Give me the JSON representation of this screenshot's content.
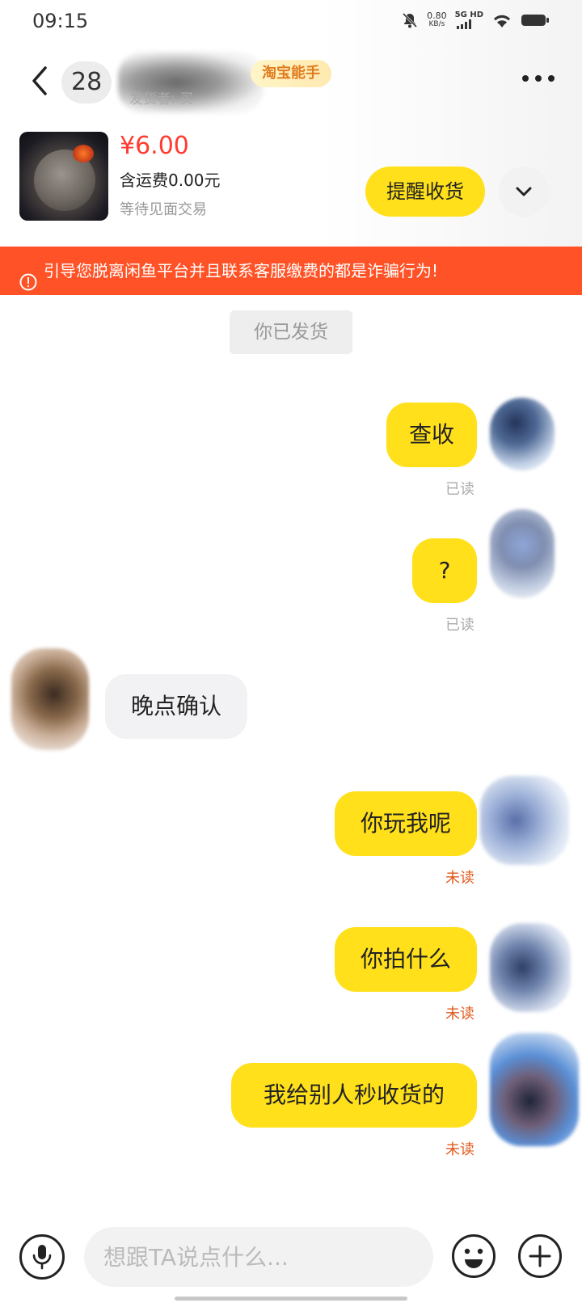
{
  "status_bar": {
    "time": "09:15",
    "net_speed": "0.80",
    "net_speed_unit": "KB/s",
    "net_type": "5G HD"
  },
  "header": {
    "unread_count": "28",
    "badge": "淘宝能手",
    "sub_line": "发货者: 买"
  },
  "product": {
    "price": "¥6.00",
    "shipping": "含运费0.00元",
    "status": "等待见面交易",
    "remind_button": "提醒收货"
  },
  "warning": {
    "text": "引导您脱离闲鱼平台并且联系客服缴费的都是诈骗行为!"
  },
  "system_message": "你已发货",
  "messages": [
    {
      "side": "mine",
      "text": "查收",
      "status": "已读"
    },
    {
      "side": "mine",
      "text": "?",
      "status": "已读"
    },
    {
      "side": "theirs",
      "text": "晚点确认",
      "status": ""
    },
    {
      "side": "mine",
      "text": "你玩我呢",
      "status": "未读"
    },
    {
      "side": "mine",
      "text": "你拍什么",
      "status": "未读"
    },
    {
      "side": "mine",
      "text": "我给别人秒收货的",
      "status": "未读"
    }
  ],
  "input": {
    "placeholder": "想跟TA说点什么..."
  },
  "colors": {
    "accent_yellow": "#ffe01b",
    "warning_orange": "#ff5226",
    "price_red": "#ff3b30",
    "unread_orange": "#e05a1c"
  }
}
